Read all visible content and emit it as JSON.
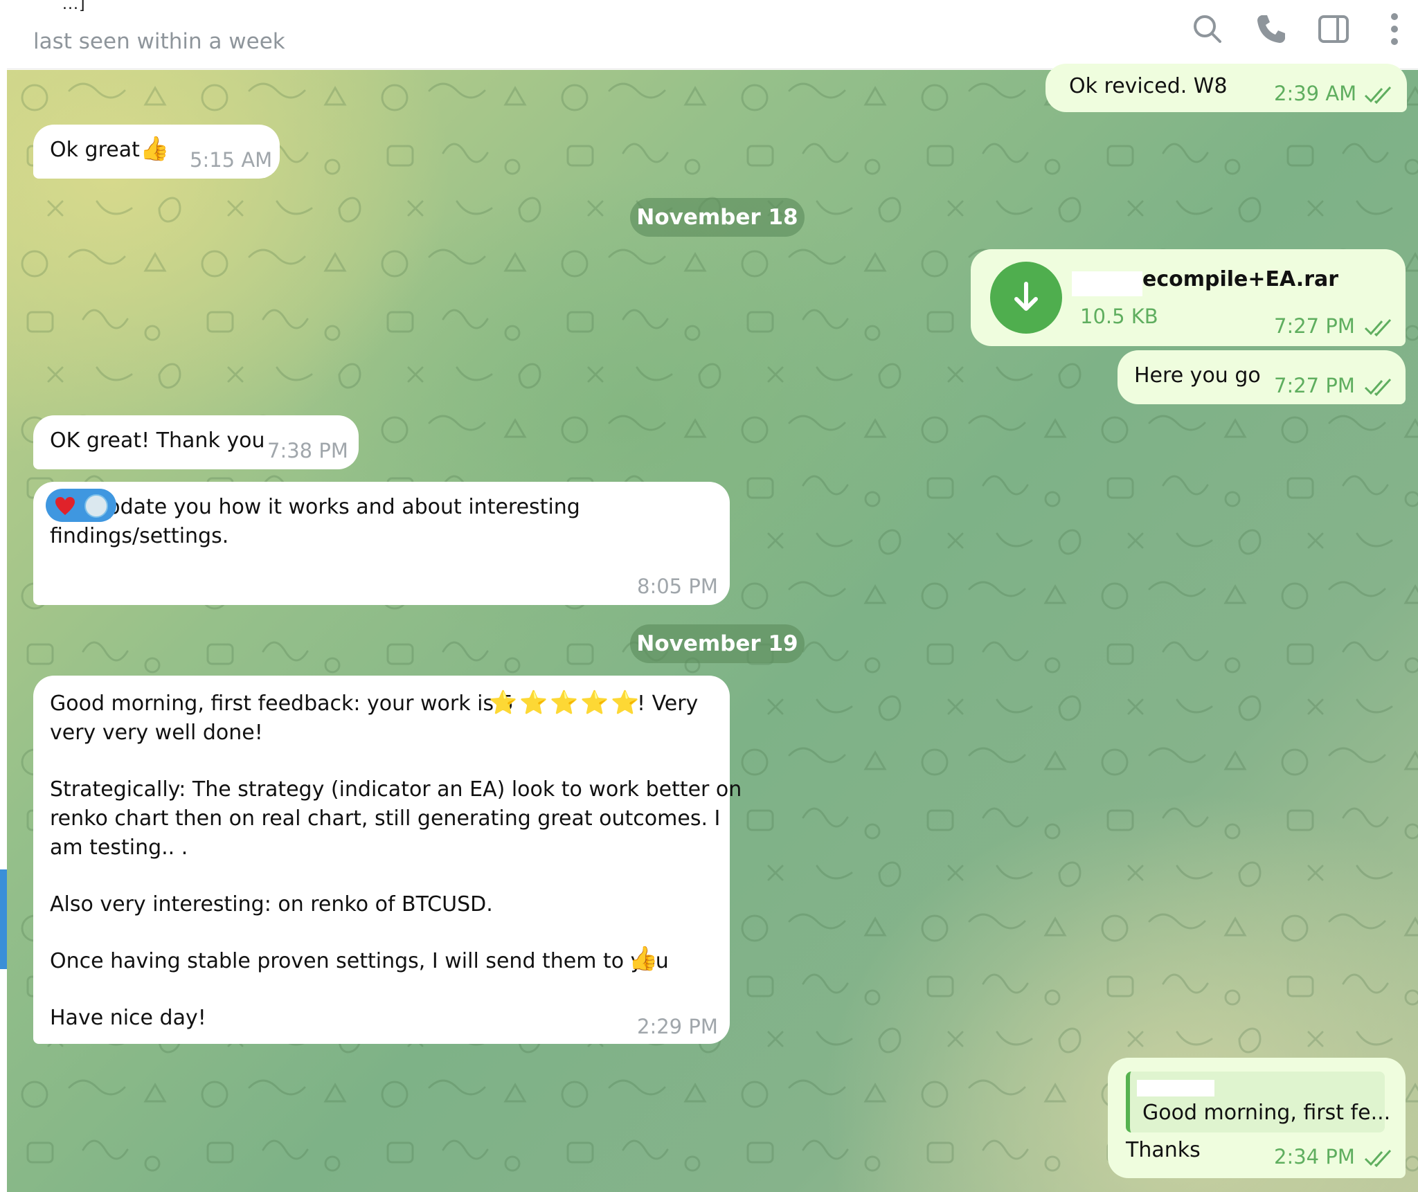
{
  "header": {
    "title_fragment": "...]",
    "status": "last seen within a week",
    "icons": [
      "search-icon",
      "phone-icon",
      "sidebar-toggle-icon",
      "more-vertical-icon"
    ]
  },
  "dates": [
    "November 18",
    "November 19"
  ],
  "messages": [
    {
      "direction": "out",
      "text": "Ok reviced. W8",
      "time": "2:39 AM",
      "read": true
    },
    {
      "direction": "in",
      "text": "Ok great",
      "emoji": "thumbs-up",
      "time": "5:15 AM"
    },
    {
      "direction": "out",
      "type": "file",
      "file_name": "Decompile+EA.rar",
      "file_name_visible": "ecompile+EA.rar",
      "file_size": "10.5 KB",
      "time": "7:27 PM",
      "read": true
    },
    {
      "direction": "out",
      "text": "Here you go",
      "time": "7:27 PM",
      "read": true
    },
    {
      "direction": "in",
      "text": "OK great! Thank you",
      "time": "7:38 PM"
    },
    {
      "direction": "in",
      "lines": [
        "Will update you how it works and about interesting",
        "findings/settings."
      ],
      "reactions": [
        "heart",
        "face"
      ],
      "time": "8:05 PM"
    },
    {
      "direction": "in",
      "lines": [
        "Good morning, first feedback: your work is 5",
        "! Very",
        "very very well done!",
        "Strategically: The strategy (indicator an EA) look to work better on",
        "renko chart then on real chart, still generating great outcomes. I",
        "am testing.. .",
        "Also very interesting: on renko of BTCUSD.",
        "Once having stable proven settings, I will send them to you",
        "Have nice day!"
      ],
      "stars": 5,
      "time": "2:29 PM"
    },
    {
      "direction": "out",
      "quote": "Good morning, first fe...",
      "text": "Thanks",
      "time": "2:34 PM",
      "read": true
    }
  ],
  "colors": {
    "incoming_bubble": "#ffffff",
    "outgoing_bubble": "#effdde",
    "outgoing_time": "#5fae5f",
    "incoming_time": "#a0a6ab",
    "date_chip": "#5c8c5c",
    "file_icon": "#4fae4e",
    "reaction_chip": "#3f97e0"
  }
}
